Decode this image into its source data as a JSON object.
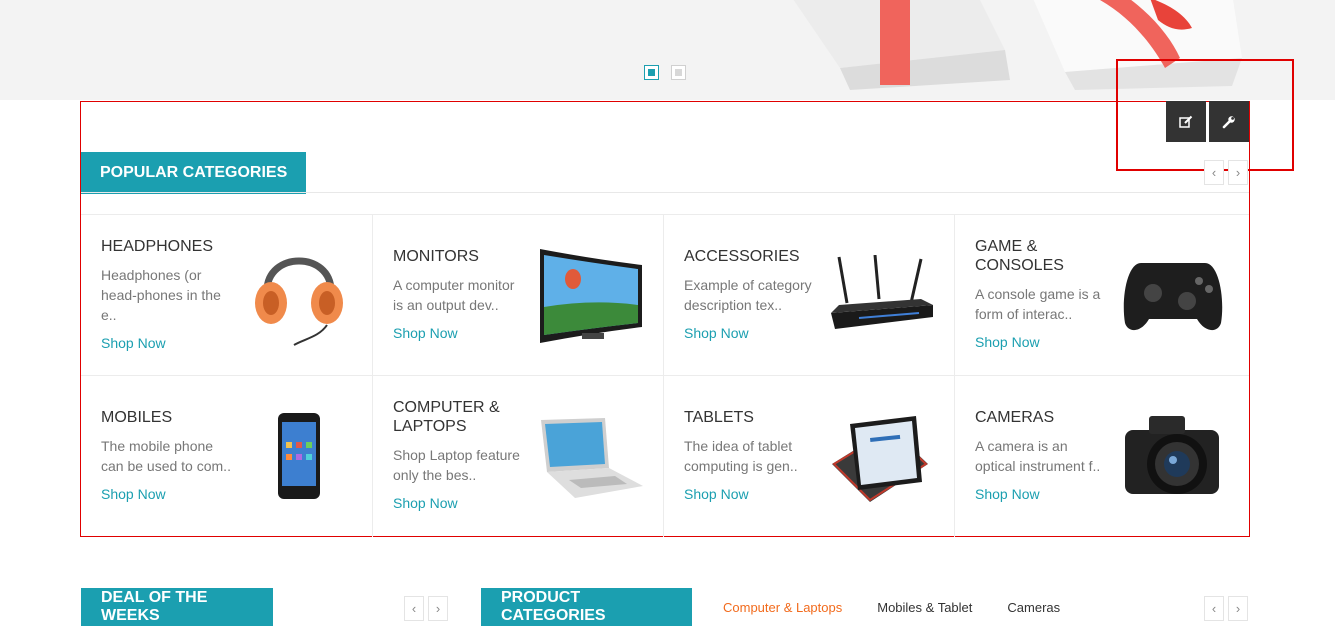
{
  "slider": {
    "dots": 2,
    "active_dot": 0
  },
  "popular": {
    "title": "POPULAR CATEGORIES",
    "categories": [
      {
        "name": "HEADPHONES",
        "desc": "Headphones (or head-phones in the e..",
        "link": "Shop Now"
      },
      {
        "name": "MONITORS",
        "desc": "A computer monitor is an output dev..",
        "link": "Shop Now"
      },
      {
        "name": "ACCESSORIES",
        "desc": "Example of category description tex..",
        "link": "Shop Now"
      },
      {
        "name": "GAME & CONSOLES",
        "desc": "A console game is a form of interac..",
        "link": "Shop Now"
      },
      {
        "name": "MOBILES",
        "desc": "The mobile phone can be used to com..",
        "link": "Shop Now"
      },
      {
        "name": "COMPUTER & LAPTOPS",
        "desc": "Shop Laptop feature only the bes..",
        "link": "Shop Now"
      },
      {
        "name": "TABLETS",
        "desc": "The idea of tablet computing is gen..",
        "link": "Shop Now"
      },
      {
        "name": "CAMERAS",
        "desc": "A camera is an optical instrument f..",
        "link": "Shop Now"
      }
    ]
  },
  "deal": {
    "title": "DEAL OF THE WEEKS"
  },
  "product_categories": {
    "title": "PRODUCT CATEGORIES",
    "tabs": [
      "Computer & Laptops",
      "Mobiles & Tablet",
      "Cameras"
    ],
    "active_tab": 0
  },
  "icons": {
    "edit": "edit-icon",
    "settings": "wrench-icon",
    "prev": "chevron-left-icon",
    "next": "chevron-right-icon"
  },
  "colors": {
    "accent": "#1b9fb0",
    "active_tab": "#f26b1d",
    "highlight": "#e00000"
  }
}
